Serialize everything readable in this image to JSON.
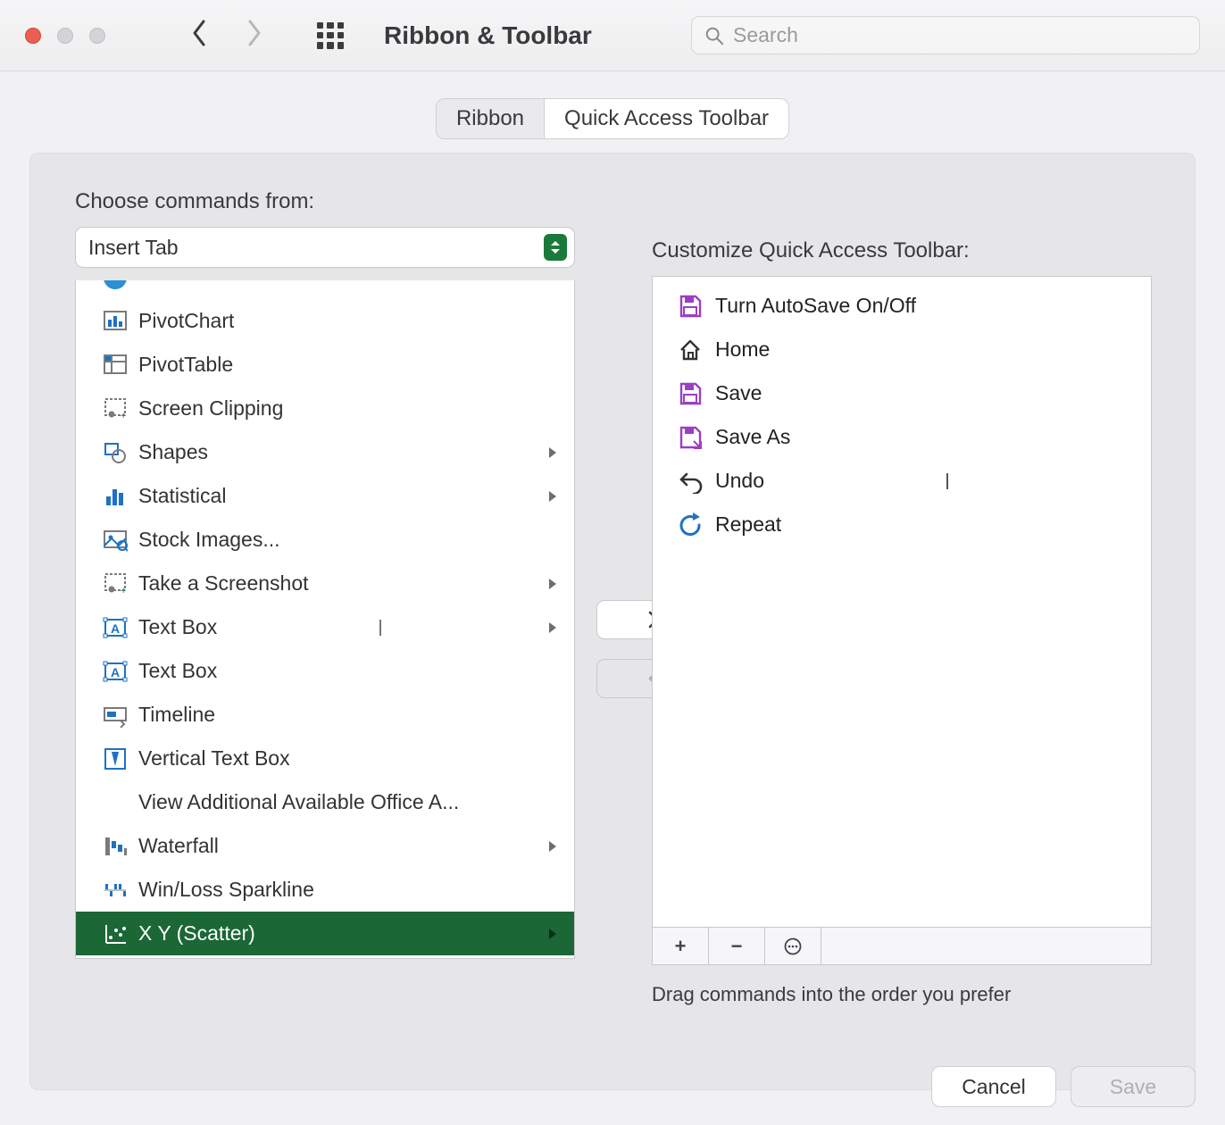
{
  "header": {
    "title": "Ribbon & Toolbar",
    "search_placeholder": "Search"
  },
  "tabs": {
    "ribbon": "Ribbon",
    "qat": "Quick Access Toolbar",
    "active": "qat"
  },
  "left": {
    "label": "Choose commands from:",
    "dropdown_value": "Insert Tab",
    "items": [
      {
        "label": "",
        "icon": "circle-partial-icon",
        "has_submenu": false
      },
      {
        "label": "PivotChart",
        "icon": "pivotchart-icon",
        "has_submenu": false
      },
      {
        "label": "PivotTable",
        "icon": "pivottable-icon",
        "has_submenu": false
      },
      {
        "label": "Screen Clipping",
        "icon": "screen-clipping-icon",
        "has_submenu": false
      },
      {
        "label": "Shapes",
        "icon": "shapes-icon",
        "has_submenu": true
      },
      {
        "label": "Statistical",
        "icon": "statistical-icon",
        "has_submenu": true
      },
      {
        "label": "Stock Images...",
        "icon": "stock-images-icon",
        "has_submenu": false
      },
      {
        "label": "Take a Screenshot",
        "icon": "screenshot-icon",
        "has_submenu": true
      },
      {
        "label": "Text Box",
        "icon": "textbox-icon",
        "has_submenu": true,
        "split": true
      },
      {
        "label": "Text Box",
        "icon": "textbox-icon",
        "has_submenu": false
      },
      {
        "label": "Timeline",
        "icon": "timeline-icon",
        "has_submenu": false
      },
      {
        "label": "Vertical Text Box",
        "icon": "vertical-textbox-icon",
        "has_submenu": false
      },
      {
        "label": "View Additional Available Office A...",
        "icon": "",
        "has_submenu": false
      },
      {
        "label": "Waterfall",
        "icon": "waterfall-icon",
        "has_submenu": true
      },
      {
        "label": "Win/Loss Sparkline",
        "icon": "winloss-icon",
        "has_submenu": false
      },
      {
        "label": "X Y (Scatter)",
        "icon": "scatter-icon",
        "has_submenu": true,
        "selected": true
      }
    ]
  },
  "right": {
    "label": "Customize Quick Access Toolbar:",
    "items": [
      {
        "label": "Turn AutoSave On/Off",
        "icon": "autosave-icon"
      },
      {
        "label": "Home",
        "icon": "home-icon"
      },
      {
        "label": "Save",
        "icon": "save-icon"
      },
      {
        "label": "Save As",
        "icon": "save-as-icon"
      },
      {
        "label": "Undo",
        "icon": "undo-icon",
        "split": true,
        "has_submenu": true
      },
      {
        "label": "Repeat",
        "icon": "repeat-icon"
      }
    ],
    "toolbar": {
      "add": "+",
      "remove": "−",
      "more": "⊙"
    },
    "hint": "Drag commands into the order you prefer"
  },
  "footer": {
    "cancel": "Cancel",
    "save": "Save"
  }
}
